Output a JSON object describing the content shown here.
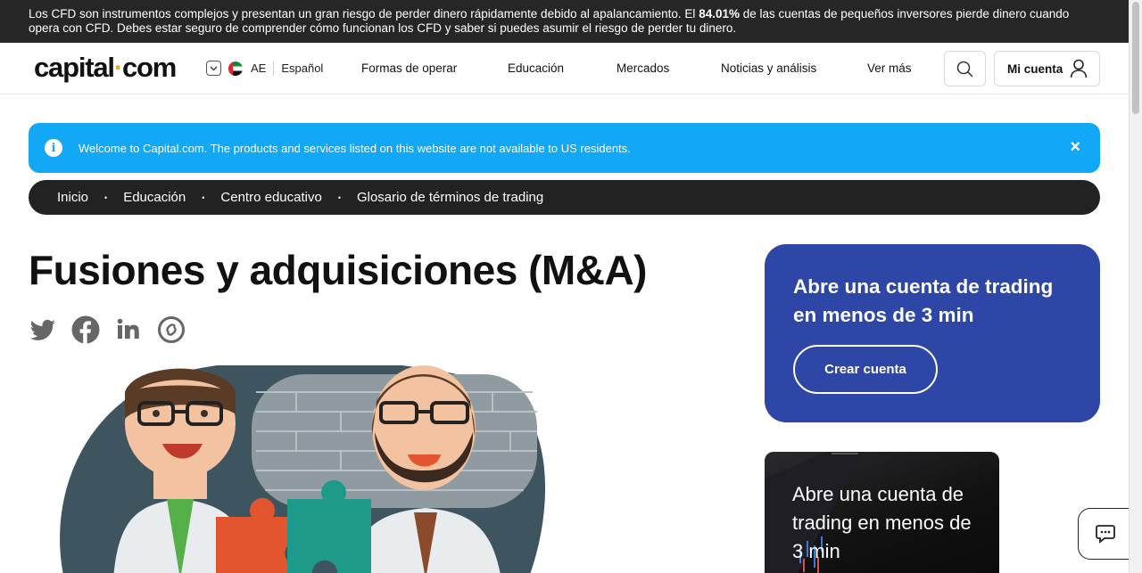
{
  "risk_banner": {
    "text_before": "Los CFD son instrumentos complejos y presentan un gran riesgo de perder dinero rápidamente debido al apalancamiento. El ",
    "percent": "84.01%",
    "text_after": " de las cuentas de pequeños inversores pierde dinero cuando opera con CFD. Debes estar seguro de comprender cómo funcionan los CFD y saber si puedes asumir el riesgo de perder tu dinero."
  },
  "header": {
    "logo_left": "capital",
    "logo_dot": "·",
    "logo_right": "com",
    "region": "AE",
    "language": "Español",
    "menu": [
      "Formas de operar",
      "Educación",
      "Mercados",
      "Noticias y análisis",
      "Ver más"
    ],
    "account_label": "Mi cuenta"
  },
  "info_bar": {
    "icon_glyph": "i",
    "text": "Welcome to Capital.com. The products and services listed on this website are not available to US residents.",
    "close_glyph": "×"
  },
  "breadcrumb": {
    "items": [
      "Inicio",
      "Educación",
      "Centro educativo",
      "Glosario de términos de trading"
    ],
    "separator": "•"
  },
  "article": {
    "title": "Fusiones y adquisiciones (M&A)",
    "share_icons": [
      "twitter-icon",
      "facebook-icon",
      "linkedin-icon",
      "copy-link-icon"
    ]
  },
  "cta_card": {
    "heading": "Abre una cuenta de trading en menos de 3 min",
    "button": "Crear cuenta"
  },
  "promo_card": {
    "text": "Abre una cuenta de trading en menos de 3 min"
  },
  "colors": {
    "risk_bg": "#262626",
    "info_blue": "#13a8f5",
    "cta_blue": "#2e47a6",
    "logo_dot": "#f5a623"
  }
}
